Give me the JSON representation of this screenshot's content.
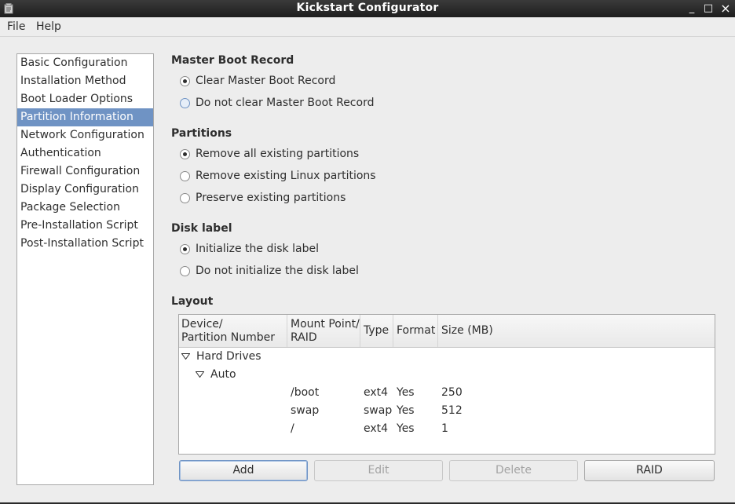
{
  "window": {
    "title": "Kickstart Configurator",
    "controls": {
      "minimize": "_",
      "maximize": "□",
      "close": "×"
    }
  },
  "menubar": {
    "items": [
      {
        "label": "File"
      },
      {
        "label": "Help"
      }
    ]
  },
  "sidebar": {
    "selected_index": 3,
    "items": [
      {
        "label": "Basic Configuration"
      },
      {
        "label": "Installation Method"
      },
      {
        "label": "Boot Loader Options"
      },
      {
        "label": "Partition Information"
      },
      {
        "label": "Network Configuration"
      },
      {
        "label": "Authentication"
      },
      {
        "label": "Firewall Configuration"
      },
      {
        "label": "Display Configuration"
      },
      {
        "label": "Package Selection"
      },
      {
        "label": "Pre-Installation Script"
      },
      {
        "label": "Post-Installation Script"
      }
    ]
  },
  "mbr": {
    "title": "Master Boot Record",
    "options": [
      {
        "label": "Clear Master Boot Record",
        "checked": true
      },
      {
        "label": "Do not clear Master Boot Record",
        "checked": false
      }
    ]
  },
  "partitions": {
    "title": "Partitions",
    "options": [
      {
        "label": "Remove all existing partitions",
        "checked": true
      },
      {
        "label": "Remove existing Linux partitions",
        "checked": false
      },
      {
        "label": "Preserve existing partitions",
        "checked": false
      }
    ]
  },
  "disklabel": {
    "title": "Disk label",
    "options": [
      {
        "label": "Initialize the disk label",
        "checked": true
      },
      {
        "label": "Do not initialize the disk label",
        "checked": false
      }
    ]
  },
  "layout": {
    "title": "Layout",
    "columns": {
      "device_line1": "Device/",
      "device_line2": "Partition Number",
      "mount_line1": "Mount Point/",
      "mount_line2": "RAID",
      "type": "Type",
      "format": "Format",
      "size": "Size (MB)"
    },
    "tree": {
      "root": "Hard Drives",
      "child": "Auto",
      "rows": [
        {
          "mount": "/boot",
          "type": "ext4",
          "format": "Yes",
          "size": "250"
        },
        {
          "mount": "swap",
          "type": "swap",
          "format": "Yes",
          "size": "512"
        },
        {
          "mount": "/",
          "type": "ext4",
          "format": "Yes",
          "size": "1"
        }
      ]
    }
  },
  "buttons": {
    "add": "Add",
    "edit": "Edit",
    "delete": "Delete",
    "raid": "RAID"
  }
}
